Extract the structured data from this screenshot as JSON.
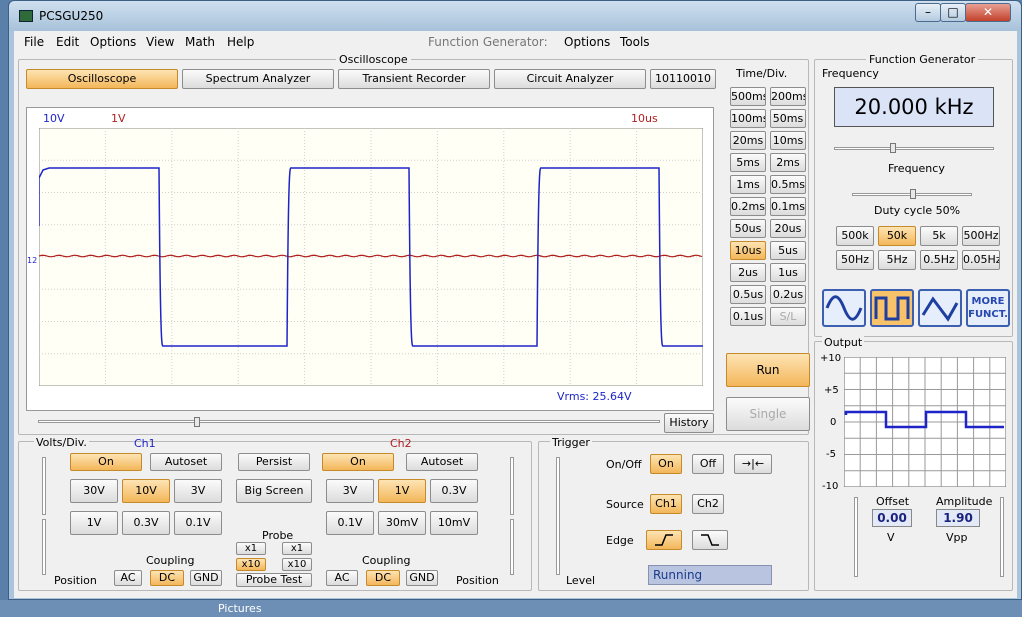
{
  "window": {
    "title": "PCSGU250",
    "min": "–",
    "max": "□",
    "close": "✕"
  },
  "menu": {
    "file": "File",
    "edit": "Edit",
    "options": "Options",
    "view": "View",
    "math": "Math",
    "help": "Help",
    "fg_label": "Function Generator:",
    "fg_options": "Options",
    "fg_tools": "Tools"
  },
  "osc": {
    "group_title": "Oscilloscope",
    "tabs": [
      "Oscilloscope",
      "Spectrum Analyzer",
      "Transient Recorder",
      "Circuit Analyzer",
      "10110010"
    ],
    "ch1_scale": "10V",
    "ch2_scale": "1V",
    "time_scale": "10us",
    "marker": "12",
    "vrms": "Vrms: 25.64V",
    "history": "History",
    "colors": {
      "ch1": "#1e24c8",
      "ch2": "#b01e1e",
      "grid": "#cfcfcf",
      "screen_bg": "#fffff6"
    }
  },
  "timediv": {
    "title": "Time/Div.",
    "items": [
      "500ms",
      "200ms",
      "100ms",
      "50ms",
      "20ms",
      "10ms",
      "5ms",
      "2ms",
      "1ms",
      "0.5ms",
      "0.2ms",
      "0.1ms",
      "50us",
      "20us",
      "10us",
      "5us",
      "2us",
      "1us",
      "0.5us",
      "0.2us",
      "0.1us",
      "S/L"
    ],
    "selected": "10us",
    "disabled": "S/L"
  },
  "run": "Run",
  "single": "Single",
  "volts": {
    "title": "Volts/Div.",
    "ch1": "Ch1",
    "ch2": "Ch2",
    "ch1_on": "On",
    "ch1_autoset": "Autoset",
    "persist": "Persist",
    "ch2_on": "On",
    "ch2_autoset": "Autoset",
    "ch1_row1": [
      "30V",
      "10V",
      "3V"
    ],
    "ch1_row2": [
      "1V",
      "0.3V",
      "0.1V"
    ],
    "big_screen": "Big Screen",
    "ch2_row1": [
      "3V",
      "1V",
      "0.3V"
    ],
    "ch2_row2": [
      "0.1V",
      "30mV",
      "10mV"
    ],
    "ch1_selected": "10V",
    "ch2_selected": "1V",
    "probe": "Probe",
    "x1a": "x1",
    "x1b": "x1",
    "x10a": "x10",
    "x10b": "x10",
    "probe_test": "Probe Test",
    "coupling": "Coupling",
    "position": "Position",
    "ac": "AC",
    "dc": "DC",
    "gnd": "GND"
  },
  "trigger": {
    "title": "Trigger",
    "onoff": "On/Off",
    "on": "On",
    "off": "Off",
    "center": "→|←",
    "source": "Source",
    "ch1": "Ch1",
    "ch2": "Ch2",
    "edge": "Edge",
    "level": "Level",
    "status": "Running"
  },
  "fg": {
    "title": "Function Generator",
    "freq_group": "Frequency",
    "freq_value": "20.000 kHz",
    "freq_label": "Frequency",
    "duty": "Duty cycle 50%",
    "ranges": [
      "500k",
      "50k",
      "5k",
      "500Hz",
      "50Hz",
      "5Hz",
      "0.5Hz",
      "0.05Hz"
    ],
    "range_selected": "50k",
    "more": "MORE FUNCT.",
    "output": "Output",
    "yticks": [
      "+10",
      "+5",
      "0",
      "-5",
      "-10"
    ],
    "offset_label": "Offset",
    "offset_value": "0.00",
    "offset_unit": "V",
    "amp_label": "Amplitude",
    "amp_value": "1.90",
    "amp_unit": "Vpp"
  },
  "desktop": {
    "pictures": "Pictures"
  }
}
